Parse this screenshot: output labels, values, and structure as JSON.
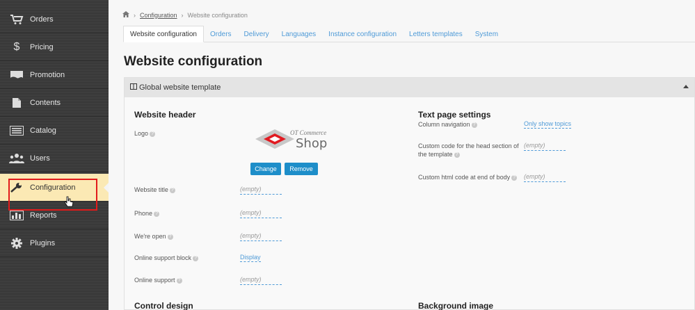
{
  "sidebar": {
    "items": [
      {
        "label": "Orders",
        "icon": "cart-icon"
      },
      {
        "label": "Pricing",
        "icon": "dollar-icon"
      },
      {
        "label": "Promotion",
        "icon": "flag-icon"
      },
      {
        "label": "Contents",
        "icon": "document-icon"
      },
      {
        "label": "Catalog",
        "icon": "list-icon"
      },
      {
        "label": "Users",
        "icon": "users-icon"
      },
      {
        "label": "Configuration",
        "icon": "wrench-icon"
      },
      {
        "label": "Reports",
        "icon": "bar-chart-icon"
      },
      {
        "label": "Plugins",
        "icon": "gear-icon"
      }
    ],
    "active": "Configuration"
  },
  "breadcrumb": {
    "home_icon": "home-icon",
    "parent": "Configuration",
    "current": "Website configuration",
    "separator": "›"
  },
  "tabs": [
    "Website configuration",
    "Orders",
    "Delivery",
    "Languages",
    "Instance configuration",
    "Letters templates",
    "System"
  ],
  "page_title": "Website configuration",
  "panel": {
    "title": "Global website template",
    "left": {
      "section_title": "Website header",
      "logo_label": "Logo",
      "logo": {
        "line1": "OT Commerce",
        "line2": "Shop"
      },
      "change_button": "Change",
      "remove_button": "Remove",
      "fields": [
        {
          "label": "Website title",
          "value": "(empty)"
        },
        {
          "label": "Phone",
          "value": "(empty)"
        },
        {
          "label": "We're open",
          "value": "(empty)"
        },
        {
          "label": "Online support block",
          "value": "Display"
        },
        {
          "label": "Online support",
          "value": "(empty)"
        }
      ],
      "next_section": "Control design"
    },
    "right": {
      "section_title": "Text page settings",
      "fields": [
        {
          "label": "Column navigation",
          "value": "Only show topics"
        },
        {
          "label": "Custom code for the head section of the template",
          "value": "(empty)"
        },
        {
          "label": "Custom html code at end of body",
          "value": "(empty)"
        }
      ],
      "next_section": "Background image"
    }
  },
  "help_glyph": "?",
  "colors": {
    "accent": "#1e8ec9",
    "link": "#4e9ad7",
    "sidebar_bg": "#3b3b3b",
    "active_bg": "#fbe9b4",
    "highlight": "#e21b1b"
  }
}
